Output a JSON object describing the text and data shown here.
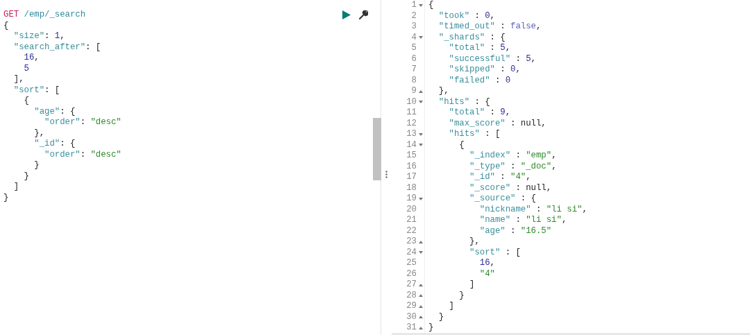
{
  "request": {
    "method": "GET",
    "path": "/emp/_search",
    "lines": [
      [
        {
          "kind": "punct",
          "text": "{"
        }
      ],
      [
        {
          "kind": "key",
          "text": "  \"size\""
        },
        {
          "kind": "punct",
          "text": ": "
        },
        {
          "kind": "number",
          "text": "1"
        },
        {
          "kind": "punct",
          "text": ","
        }
      ],
      [
        {
          "kind": "key",
          "text": "  \"search_after\""
        },
        {
          "kind": "punct",
          "text": ": ["
        }
      ],
      [
        {
          "kind": "number",
          "text": "    16"
        },
        {
          "kind": "punct",
          "text": ","
        }
      ],
      [
        {
          "kind": "number",
          "text": "    5"
        }
      ],
      [
        {
          "kind": "punct",
          "text": "  ],"
        }
      ],
      [
        {
          "kind": "key",
          "text": "  \"sort\""
        },
        {
          "kind": "punct",
          "text": ": ["
        }
      ],
      [
        {
          "kind": "punct",
          "text": "    {"
        }
      ],
      [
        {
          "kind": "key",
          "text": "      \"age\""
        },
        {
          "kind": "punct",
          "text": ": {"
        }
      ],
      [
        {
          "kind": "key",
          "text": "        \"order\""
        },
        {
          "kind": "punct",
          "text": ": "
        },
        {
          "kind": "string",
          "text": "\"desc\""
        }
      ],
      [
        {
          "kind": "punct",
          "text": "      },"
        }
      ],
      [
        {
          "kind": "key",
          "text": "      \"_id\""
        },
        {
          "kind": "punct",
          "text": ": {"
        }
      ],
      [
        {
          "kind": "key",
          "text": "        \"order\""
        },
        {
          "kind": "punct",
          "text": ": "
        },
        {
          "kind": "string",
          "text": "\"desc\""
        }
      ],
      [
        {
          "kind": "punct",
          "text": "      }"
        }
      ],
      [
        {
          "kind": "punct",
          "text": "    }"
        }
      ],
      [
        {
          "kind": "punct",
          "text": "  ]"
        }
      ],
      [
        {
          "kind": "punct",
          "text": "}"
        }
      ]
    ]
  },
  "response": {
    "lines": [
      {
        "n": "1",
        "kind": "opening",
        "tokens": [
          {
            "kind": "punct",
            "text": "{"
          }
        ]
      },
      {
        "n": "2",
        "kind": "plain",
        "tokens": [
          {
            "kind": "key",
            "text": "  \"took\""
          },
          {
            "kind": "punct",
            "text": " : "
          },
          {
            "kind": "number",
            "text": "0"
          },
          {
            "kind": "punct",
            "text": ","
          }
        ]
      },
      {
        "n": "3",
        "kind": "plain",
        "tokens": [
          {
            "kind": "key",
            "text": "  \"timed_out\""
          },
          {
            "kind": "punct",
            "text": " : "
          },
          {
            "kind": "bool",
            "text": "false"
          },
          {
            "kind": "punct",
            "text": ","
          }
        ]
      },
      {
        "n": "4",
        "kind": "opening",
        "tokens": [
          {
            "kind": "key",
            "text": "  \"_shards\""
          },
          {
            "kind": "punct",
            "text": " : {"
          }
        ]
      },
      {
        "n": "5",
        "kind": "plain",
        "tokens": [
          {
            "kind": "key",
            "text": "    \"total\""
          },
          {
            "kind": "punct",
            "text": " : "
          },
          {
            "kind": "number",
            "text": "5"
          },
          {
            "kind": "punct",
            "text": ","
          }
        ]
      },
      {
        "n": "6",
        "kind": "plain",
        "tokens": [
          {
            "kind": "key",
            "text": "    \"successful\""
          },
          {
            "kind": "punct",
            "text": " : "
          },
          {
            "kind": "number",
            "text": "5"
          },
          {
            "kind": "punct",
            "text": ","
          }
        ]
      },
      {
        "n": "7",
        "kind": "plain",
        "tokens": [
          {
            "kind": "key",
            "text": "    \"skipped\""
          },
          {
            "kind": "punct",
            "text": " : "
          },
          {
            "kind": "number",
            "text": "0"
          },
          {
            "kind": "punct",
            "text": ","
          }
        ]
      },
      {
        "n": "8",
        "kind": "plain",
        "tokens": [
          {
            "kind": "key",
            "text": "    \"failed\""
          },
          {
            "kind": "punct",
            "text": " : "
          },
          {
            "kind": "number",
            "text": "0"
          }
        ]
      },
      {
        "n": "9",
        "kind": "closing",
        "tokens": [
          {
            "kind": "punct",
            "text": "  },"
          }
        ]
      },
      {
        "n": "10",
        "kind": "opening",
        "tokens": [
          {
            "kind": "key",
            "text": "  \"hits\""
          },
          {
            "kind": "punct",
            "text": " : {"
          }
        ]
      },
      {
        "n": "11",
        "kind": "plain",
        "tokens": [
          {
            "kind": "key",
            "text": "    \"total\""
          },
          {
            "kind": "punct",
            "text": " : "
          },
          {
            "kind": "number",
            "text": "9"
          },
          {
            "kind": "punct",
            "text": ","
          }
        ]
      },
      {
        "n": "12",
        "kind": "plain",
        "tokens": [
          {
            "kind": "key",
            "text": "    \"max_score\""
          },
          {
            "kind": "punct",
            "text": " : null,"
          }
        ]
      },
      {
        "n": "13",
        "kind": "opening",
        "tokens": [
          {
            "kind": "key",
            "text": "    \"hits\""
          },
          {
            "kind": "punct",
            "text": " : ["
          }
        ]
      },
      {
        "n": "14",
        "kind": "opening",
        "tokens": [
          {
            "kind": "punct",
            "text": "      {"
          }
        ]
      },
      {
        "n": "15",
        "kind": "plain",
        "tokens": [
          {
            "kind": "key",
            "text": "        \"_index\""
          },
          {
            "kind": "punct",
            "text": " : "
          },
          {
            "kind": "string",
            "text": "\"emp\""
          },
          {
            "kind": "punct",
            "text": ","
          }
        ]
      },
      {
        "n": "16",
        "kind": "plain",
        "tokens": [
          {
            "kind": "key",
            "text": "        \"_type\""
          },
          {
            "kind": "punct",
            "text": " : "
          },
          {
            "kind": "string",
            "text": "\"_doc\""
          },
          {
            "kind": "punct",
            "text": ","
          }
        ]
      },
      {
        "n": "17",
        "kind": "plain",
        "tokens": [
          {
            "kind": "key",
            "text": "        \"_id\""
          },
          {
            "kind": "punct",
            "text": " : "
          },
          {
            "kind": "string",
            "text": "\"4\""
          },
          {
            "kind": "punct",
            "text": ","
          }
        ]
      },
      {
        "n": "18",
        "kind": "plain",
        "tokens": [
          {
            "kind": "key",
            "text": "        \"_score\""
          },
          {
            "kind": "punct",
            "text": " : null,"
          }
        ]
      },
      {
        "n": "19",
        "kind": "opening",
        "tokens": [
          {
            "kind": "key",
            "text": "        \"_source\""
          },
          {
            "kind": "punct",
            "text": " : {"
          }
        ]
      },
      {
        "n": "20",
        "kind": "plain",
        "tokens": [
          {
            "kind": "key",
            "text": "          \"nickname\""
          },
          {
            "kind": "punct",
            "text": " : "
          },
          {
            "kind": "string",
            "text": "\"li si\""
          },
          {
            "kind": "punct",
            "text": ","
          }
        ]
      },
      {
        "n": "21",
        "kind": "plain",
        "tokens": [
          {
            "kind": "key",
            "text": "          \"name\""
          },
          {
            "kind": "punct",
            "text": " : "
          },
          {
            "kind": "string",
            "text": "\"li si\""
          },
          {
            "kind": "punct",
            "text": ","
          }
        ]
      },
      {
        "n": "22",
        "kind": "plain",
        "tokens": [
          {
            "kind": "key",
            "text": "          \"age\""
          },
          {
            "kind": "punct",
            "text": " : "
          },
          {
            "kind": "string",
            "text": "\"16.5\""
          }
        ]
      },
      {
        "n": "23",
        "kind": "closing",
        "tokens": [
          {
            "kind": "punct",
            "text": "        },"
          }
        ]
      },
      {
        "n": "24",
        "kind": "opening",
        "tokens": [
          {
            "kind": "key",
            "text": "        \"sort\""
          },
          {
            "kind": "punct",
            "text": " : ["
          }
        ]
      },
      {
        "n": "25",
        "kind": "plain",
        "tokens": [
          {
            "kind": "number",
            "text": "          16"
          },
          {
            "kind": "punct",
            "text": ","
          }
        ]
      },
      {
        "n": "26",
        "kind": "plain",
        "tokens": [
          {
            "kind": "string",
            "text": "          \"4\""
          }
        ]
      },
      {
        "n": "27",
        "kind": "closing",
        "tokens": [
          {
            "kind": "punct",
            "text": "        ]"
          }
        ]
      },
      {
        "n": "28",
        "kind": "closing",
        "tokens": [
          {
            "kind": "punct",
            "text": "      }"
          }
        ]
      },
      {
        "n": "29",
        "kind": "closing",
        "tokens": [
          {
            "kind": "punct",
            "text": "    ]"
          }
        ]
      },
      {
        "n": "30",
        "kind": "closing",
        "tokens": [
          {
            "kind": "punct",
            "text": "  }"
          }
        ]
      },
      {
        "n": "31",
        "kind": "closing",
        "tokens": [
          {
            "kind": "punct",
            "text": "}"
          }
        ]
      }
    ]
  }
}
